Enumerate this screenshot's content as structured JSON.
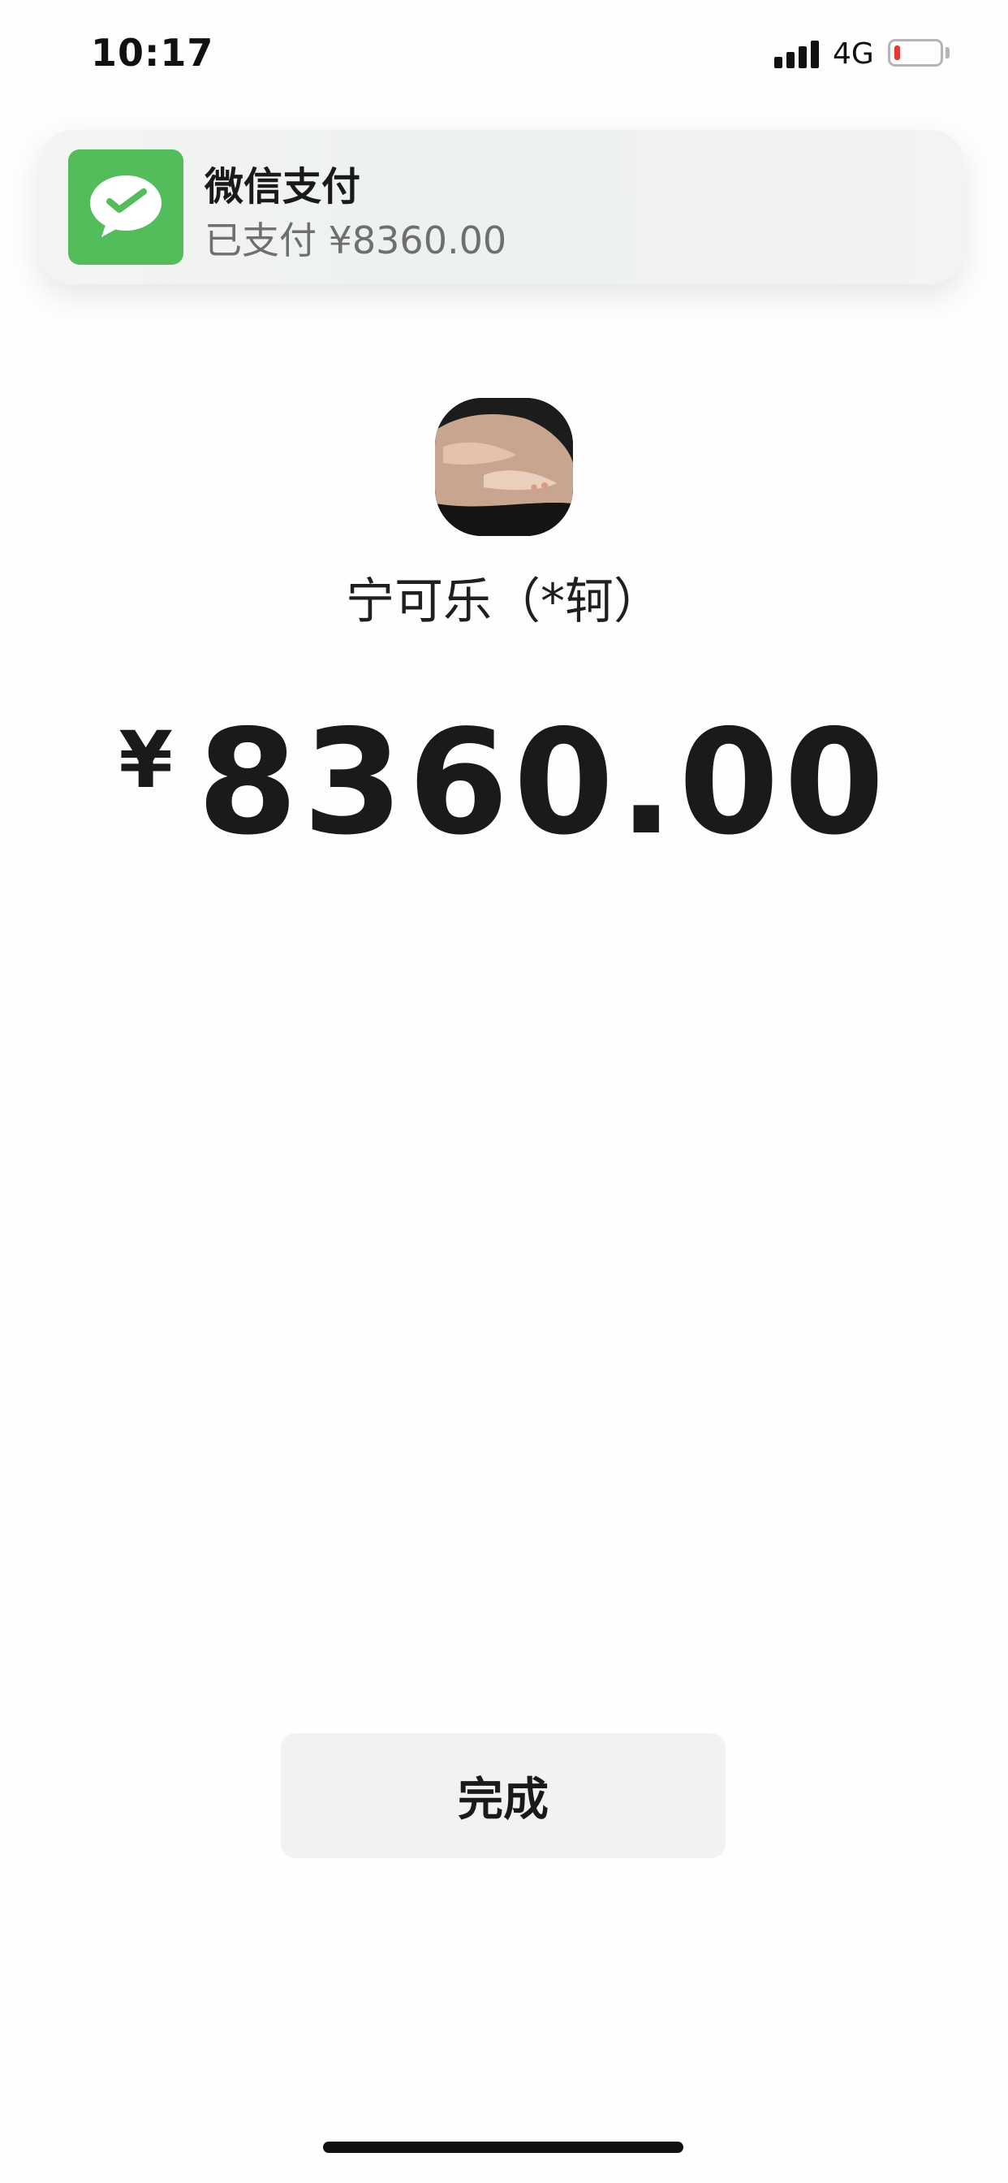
{
  "status_bar": {
    "time": "10:17",
    "network": "4G",
    "battery_level": 0.12,
    "battery_color": "#e53935",
    "signal_bars": 4
  },
  "notification": {
    "app_icon": "wechat-pay-icon",
    "icon_color": "#52bd5a",
    "title": "微信支付",
    "body": "已支付 ¥8360.00"
  },
  "payee": {
    "name": "宁可乐（*轲）"
  },
  "payment": {
    "currency": "¥",
    "amount": "8360.00"
  },
  "actions": {
    "done_label": "完成"
  }
}
